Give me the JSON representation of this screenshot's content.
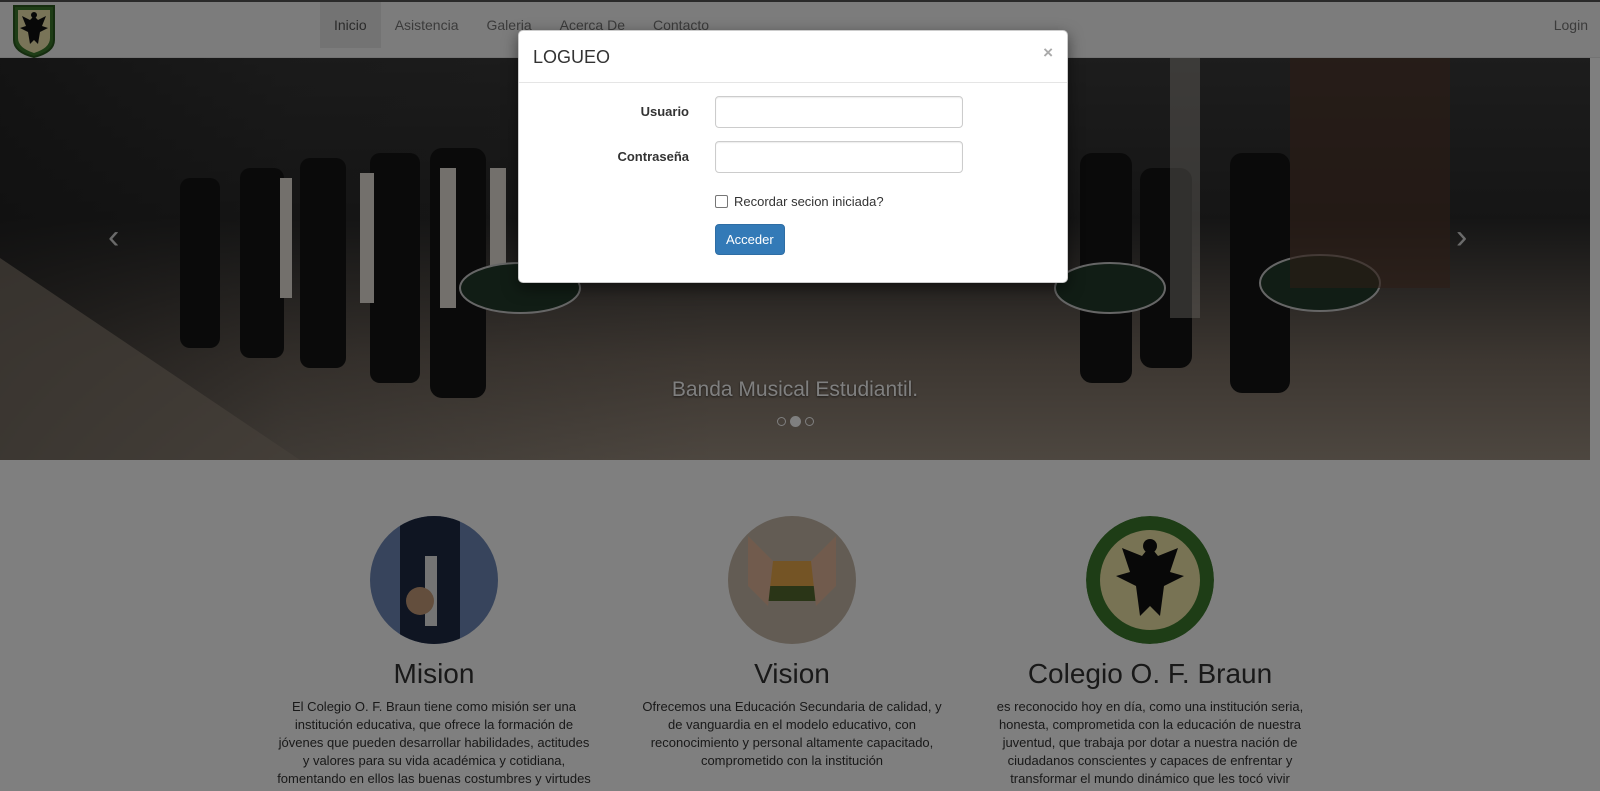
{
  "navbar": {
    "brand_icon": "eagle-crest-icon",
    "items": [
      {
        "label": "Inicio",
        "active": true
      },
      {
        "label": "Asistencia"
      },
      {
        "label": "Galeria"
      },
      {
        "label": "Acerca De"
      },
      {
        "label": "Contacto"
      }
    ],
    "login_label": "Login"
  },
  "carousel": {
    "caption": "Banda Musical Estudiantil.",
    "indicators": 3,
    "active_index": 1,
    "prev_icon": "chevron-left-icon",
    "next_icon": "chevron-right-icon"
  },
  "marketing": {
    "columns": [
      {
        "title": "Mision",
        "text": "El Colegio O. F. Braun tiene como misión ser una institución educativa, que ofrece la formación de jóvenes que pueden desarrollar habilidades, actitudes y valores para su vida académica y cotidiana, fomentando en ellos las buenas costumbres y virtudes"
      },
      {
        "title": "Vision",
        "text": "Ofrecemos una Educación Secundaria de calidad, y de vanguardia en el modelo educativo, con reconocimiento y personal altamente capacitado, comprometido con la institución"
      },
      {
        "title": "Colegio O. F. Braun",
        "text": "es reconocido hoy en día, como una institución seria, honesta, comprometida con la educación de nuestra juventud, que trabaja por dotar a nuestra nación de ciudadanos conscientes y capaces de enfrentar y transformar el mundo dinámico que les tocó vivir"
      }
    ]
  },
  "modal": {
    "title": "LOGUEO",
    "close_label": "×",
    "usuario_label": "Usuario",
    "usuario_value": "",
    "password_label": "Contraseña",
    "password_value": "",
    "remember_label": "Recordar secion iniciada?",
    "submit_label": "Acceder"
  },
  "colors": {
    "primary": "#337ab7",
    "navbar_bg": "#f8f8f8",
    "backdrop": "rgba(0,0,0,0.5)"
  }
}
